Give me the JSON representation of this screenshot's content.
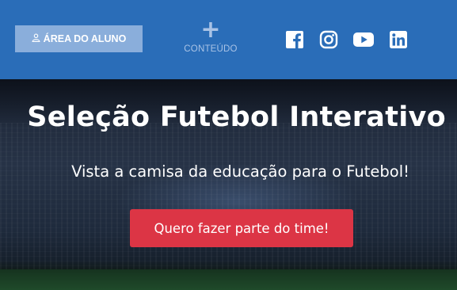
{
  "header": {
    "student_area_label": "ÁREA DO ALUNO",
    "content_plus": "+",
    "content_label": "CONTEÚDO",
    "social": [
      "facebook-icon",
      "instagram-icon",
      "youtube-icon",
      "linkedin-icon"
    ],
    "colors": {
      "bar": "#2a6db8",
      "button": "#8aaedb"
    }
  },
  "hero": {
    "title": "Seleção Futebol Interativo",
    "subtitle": "Vista a camisa da educação para o Futebol!",
    "cta_label": "Quero fazer parte do time!",
    "colors": {
      "cta": "#dc3545"
    }
  }
}
